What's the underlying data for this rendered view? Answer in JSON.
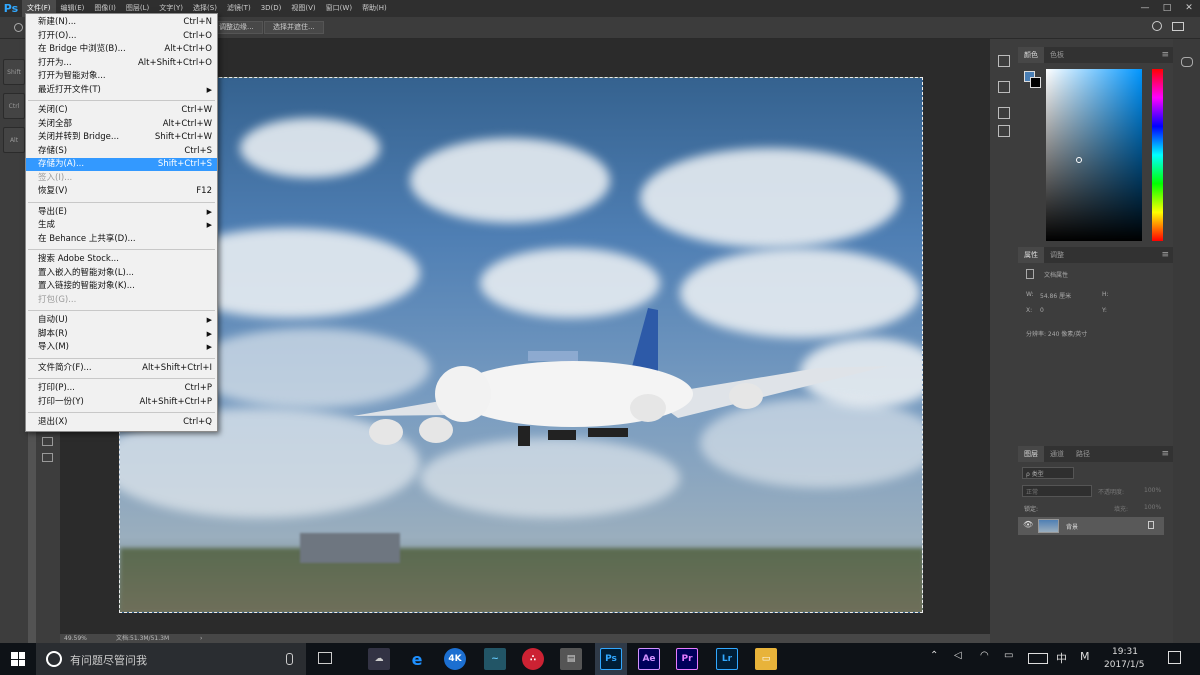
{
  "menubar": {
    "logo": "Ps",
    "items": [
      "文件(F)",
      "编辑(E)",
      "图像(I)",
      "图层(L)",
      "文字(Y)",
      "选择(S)",
      "滤镜(T)",
      "3D(D)",
      "视图(V)",
      "窗口(W)",
      "帮助(H)"
    ],
    "window_controls": [
      "—",
      "□",
      "✕"
    ]
  },
  "options_bar": {
    "refine_edge": "调整边缘...",
    "select_mask": "选择并遮住..."
  },
  "tools_left": [
    "Shift",
    "Ctrl",
    "Alt"
  ],
  "file_menu": [
    {
      "label": "新建(N)...",
      "shortcut": "Ctrl+N"
    },
    {
      "label": "打开(O)...",
      "shortcut": "Ctrl+O"
    },
    {
      "label": "在 Bridge 中浏览(B)...",
      "shortcut": "Alt+Ctrl+O"
    },
    {
      "label": "打开为...",
      "shortcut": "Alt+Shift+Ctrl+O"
    },
    {
      "label": "打开为智能对象...",
      "shortcut": ""
    },
    {
      "label": "最近打开文件(T)",
      "shortcut": "",
      "submenu": true
    },
    {
      "sep": true
    },
    {
      "label": "关闭(C)",
      "shortcut": "Ctrl+W"
    },
    {
      "label": "关闭全部",
      "shortcut": "Alt+Ctrl+W"
    },
    {
      "label": "关闭并转到 Bridge...",
      "shortcut": "Shift+Ctrl+W"
    },
    {
      "label": "存储(S)",
      "shortcut": "Ctrl+S"
    },
    {
      "label": "存储为(A)...",
      "shortcut": "Shift+Ctrl+S",
      "highlighted": true
    },
    {
      "label": "签入(I)...",
      "shortcut": "",
      "disabled": true
    },
    {
      "label": "恢复(V)",
      "shortcut": "F12"
    },
    {
      "sep": true
    },
    {
      "label": "导出(E)",
      "shortcut": "",
      "submenu": true
    },
    {
      "label": "生成",
      "shortcut": "",
      "submenu": true
    },
    {
      "label": "在 Behance 上共享(D)...",
      "shortcut": ""
    },
    {
      "sep": true
    },
    {
      "label": "搜索 Adobe Stock...",
      "shortcut": ""
    },
    {
      "label": "置入嵌入的智能对象(L)...",
      "shortcut": ""
    },
    {
      "label": "置入链接的智能对象(K)...",
      "shortcut": ""
    },
    {
      "label": "打包(G)...",
      "shortcut": "",
      "disabled": true
    },
    {
      "sep": true
    },
    {
      "label": "自动(U)",
      "shortcut": "",
      "submenu": true
    },
    {
      "label": "脚本(R)",
      "shortcut": "",
      "submenu": true
    },
    {
      "label": "导入(M)",
      "shortcut": "",
      "submenu": true
    },
    {
      "sep": true
    },
    {
      "label": "文件简介(F)...",
      "shortcut": "Alt+Shift+Ctrl+I"
    },
    {
      "sep": true
    },
    {
      "label": "打印(P)...",
      "shortcut": "Ctrl+P"
    },
    {
      "label": "打印一份(Y)",
      "shortcut": "Alt+Shift+Ctrl+P"
    },
    {
      "sep": true
    },
    {
      "label": "退出(X)",
      "shortcut": "Ctrl+Q"
    }
  ],
  "status": {
    "zoom": "49.59%",
    "doc": "文档:51.3M/51.3M",
    "arrow": "›"
  },
  "color_panel": {
    "tabs": [
      "颜色",
      "色板"
    ],
    "menu": "≡"
  },
  "properties_panel": {
    "tabs": [
      "属性",
      "调整"
    ],
    "doc_props": "文档属性",
    "w_label": "W:",
    "w_value": "54.86 厘米",
    "h_label": "H:",
    "x_label": "X:",
    "x_value": "0",
    "y_label": "Y:",
    "resolution": "分辨率: 240 像素/英寸",
    "menu": "≡"
  },
  "layers_panel": {
    "tabs": [
      "图层",
      "通道",
      "路径"
    ],
    "kind": "ρ 类型",
    "mode": "正常",
    "opacity_label": "不透明度:",
    "opacity": "100%",
    "lock_label": "锁定:",
    "fill_label": "填充:",
    "fill": "100%",
    "layer_name": "背景",
    "menu": "≡"
  },
  "taskbar": {
    "search_placeholder": "有问题尽管问我",
    "apps": [
      "e",
      "4K",
      "Ps",
      "Ae",
      "Pr",
      "Lr"
    ],
    "ime": "中",
    "ime2": "M",
    "time": "19:31",
    "date": "2017/1/5"
  }
}
